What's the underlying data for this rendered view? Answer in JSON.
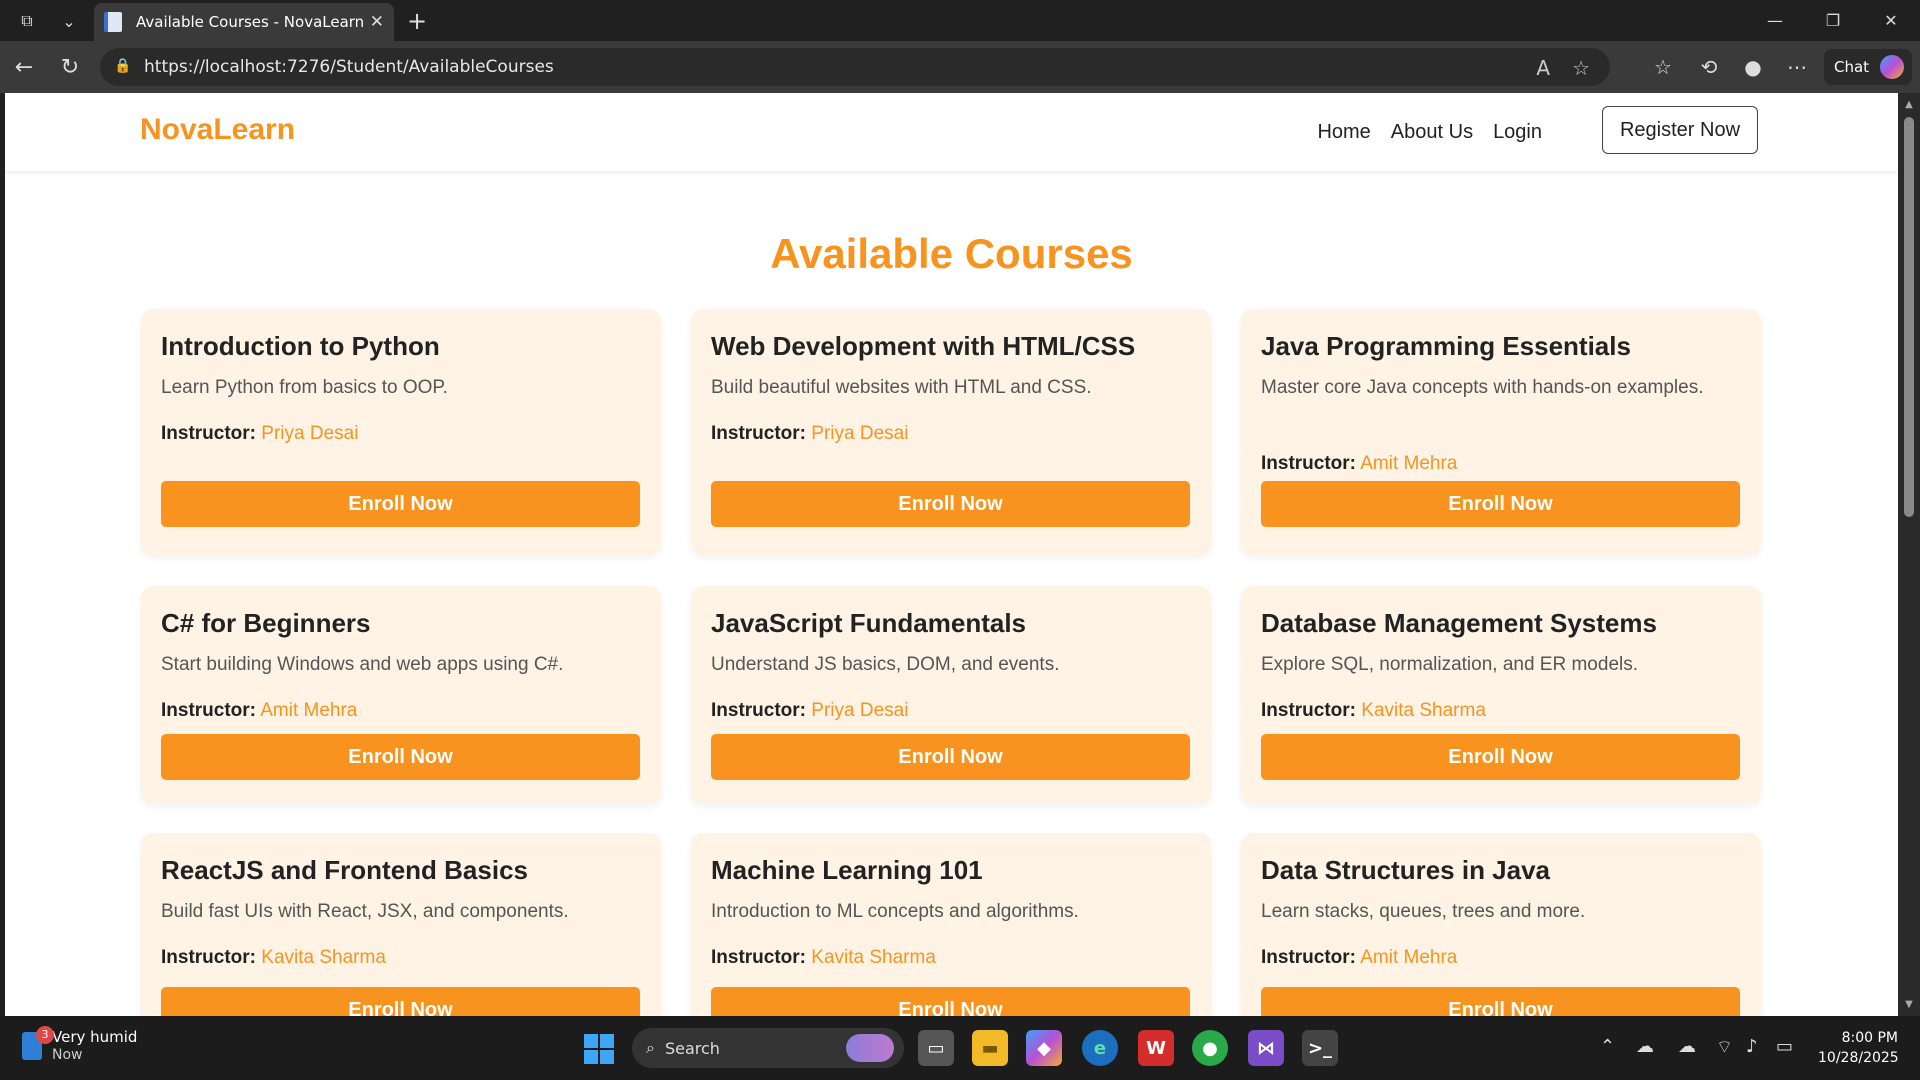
{
  "browser": {
    "tab_title": "Available Courses - NovaLearn",
    "url": "https://localhost:7276/Student/AvailableCourses",
    "chat_label": "Chat"
  },
  "site": {
    "brand": "NovaLearn",
    "nav": [
      "Home",
      "About Us",
      "Login"
    ],
    "register_label": "Register Now",
    "page_title": "Available Courses",
    "accent_color": "#f7931e"
  },
  "courses": [
    {
      "title": "Introduction to Python",
      "description": "Learn Python from basics to OOP.",
      "instructor_label": "Instructor:",
      "instructor": "Priya Desai",
      "button": "Enroll Now"
    },
    {
      "title": "Web Development with HTML/CSS",
      "description": "Build beautiful websites with HTML and CSS.",
      "instructor_label": "Instructor:",
      "instructor": "Priya Desai",
      "button": "Enroll Now"
    },
    {
      "title": "Java Programming Essentials",
      "description": "Master core Java concepts with hands-on examples.",
      "instructor_label": "Instructor:",
      "instructor": "Amit Mehra",
      "button": "Enroll Now"
    },
    {
      "title": "C# for Beginners",
      "description": "Start building Windows and web apps using C#.",
      "instructor_label": "Instructor:",
      "instructor": "Amit Mehra",
      "button": "Enroll Now"
    },
    {
      "title": "JavaScript Fundamentals",
      "description": "Understand JS basics, DOM, and events.",
      "instructor_label": "Instructor:",
      "instructor": "Priya Desai",
      "button": "Enroll Now"
    },
    {
      "title": "Database Management Systems",
      "description": "Explore SQL, normalization, and ER models.",
      "instructor_label": "Instructor:",
      "instructor": "Kavita Sharma",
      "button": "Enroll Now"
    },
    {
      "title": "ReactJS and Frontend Basics",
      "description": "Build fast UIs with React, JSX, and components.",
      "instructor_label": "Instructor:",
      "instructor": "Kavita Sharma",
      "button": "Enroll Now"
    },
    {
      "title": "Machine Learning 101",
      "description": "Introduction to ML concepts and algorithms.",
      "instructor_label": "Instructor:",
      "instructor": "Kavita Sharma",
      "button": "Enroll Now"
    },
    {
      "title": "Data Structures in Java",
      "description": "Learn stacks, queues, trees and more.",
      "instructor_label": "Instructor:",
      "instructor": "Amit Mehra",
      "button": "Enroll Now"
    }
  ],
  "taskbar": {
    "weather_text": "Very humid",
    "weather_sub": "Now",
    "weather_badge": "3",
    "search_label": "Search",
    "time": "8:00 PM",
    "date": "10/28/2025"
  }
}
